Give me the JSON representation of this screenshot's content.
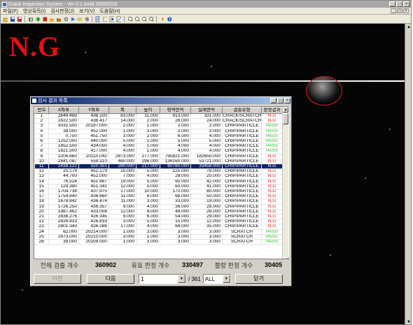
{
  "window": {
    "title": "Crack Inspection System - Ver 0.1 build 20050226",
    "minimize": "_",
    "maximize": "□",
    "close": "×"
  },
  "menu": {
    "items": [
      "파일(F)",
      "영상획득(I)",
      "검사판정(J)",
      "보기(V)",
      "도움말(H)"
    ],
    "mdi_min": "_",
    "mdi_max": "□",
    "mdi_close": "×"
  },
  "toolbar": {
    "buttons": [
      "open-icon",
      "save-icon",
      "save-as-icon",
      "camera-icon",
      "grab-icon",
      "stop-icon",
      "folder-open-icon",
      "folder-save-icon",
      "settings-icon",
      "run-icon",
      "measure-icon",
      "palette-icon",
      "grid-icon",
      "select-icon",
      "area-icon",
      "line-icon",
      "zoom-in-icon",
      "zoom-out-icon",
      "zoom-fit-icon",
      "zoom-icon",
      "info-icon",
      "help-icon"
    ]
  },
  "image": {
    "verdict": "N.G",
    "verdict_color": "#e01010",
    "defect_marker_color": "#e02020"
  },
  "dialog": {
    "title": "검사 결과 목록",
    "columns": [
      "번호",
      "X좌표",
      "Y좌표",
      "폭",
      "높이",
      "영역면적",
      "실제면적",
      "결출유형",
      "판정결과"
    ],
    "rows": [
      [
        "1",
        "2649.489",
        "436.100",
        "83.000",
        "11.000",
        "913.000",
        "331.000",
        "CRACK/SCRATCH",
        "N.G"
      ],
      [
        "2",
        "1622.500",
        "436.417",
        "14.000",
        "2.000",
        "28.000",
        "24.000",
        "CRACK/SCRATCH",
        "N.G"
      ],
      [
        "3",
        "3032.500",
        "20187.000",
        "2.000",
        "1.000",
        "2.000",
        "2.000",
        "CHIP/PARTICLE",
        "PASS"
      ],
      [
        "4",
        "38.000",
        "452.000",
        "1.000",
        "3.000",
        "3.000",
        "3.000",
        "CHIP/PARTICLE",
        "PASS"
      ],
      [
        "5",
        "0.750",
        "451.750",
        "3.000",
        "2.000",
        "6.000",
        "4.000",
        "CHIP/PARTICLE",
        "PASS"
      ],
      [
        "6",
        "1252.000",
        "440.000",
        "5.000",
        "1.000",
        "5.000",
        "5.000",
        "CHIP/PARTICLE",
        "PASS"
      ],
      [
        "7",
        "1852.500",
        "434.000",
        "4.000",
        "1.000",
        "4.000",
        "4.000",
        "CHIP/PARTICLE",
        "PASS"
      ],
      [
        "8",
        "1821.500",
        "417.000",
        "4.000",
        "1.000",
        "4.000",
        "4.000",
        "CHIP/PARTICLE",
        "PASS"
      ],
      [
        "9",
        "2206.660",
        "20110.042",
        "2873.000",
        "277.000",
        "795821.000",
        "182650.000",
        "CHIP/PARTICLE",
        "N.G"
      ],
      [
        "10",
        "2841.087",
        "558.310",
        "460.000",
        "296.000",
        "136160.000",
        "53721.000",
        "CHIP/PARTICLE",
        "N.G"
      ],
      [
        "11",
        "2438.122",
        "520.351",
        "280.000",
        "217.000",
        "60760.000",
        "33458.000",
        "CHIP/PARTICLE",
        "N.G"
      ],
      [
        "12",
        "20.179",
        "452.179",
        "25.000",
        "5.000",
        "125.000",
        "78.000",
        "CHIP/PARTICLE",
        "N.G"
      ],
      [
        "13",
        "44.700",
        "452.000",
        "7.000",
        "4.000",
        "28.000",
        "20.000",
        "CHIP/PARTICLE",
        "N.G"
      ],
      [
        "14",
        "76.524",
        "451.667",
        "19.000",
        "5.000",
        "95.000",
        "42.000",
        "CHIP/PARTICLE",
        "N.G"
      ],
      [
        "15",
        "129.390",
        "451.341",
        "12.000",
        "5.000",
        "60.000",
        "41.000",
        "CHIP/PARTICLE",
        "N.G"
      ],
      [
        "16",
        "1704.738",
        "437.975",
        "17.000",
        "10.000",
        "170.000",
        "80.000",
        "CHIP/PARTICLE",
        "N.G"
      ],
      [
        "17",
        "1754.840",
        "436.660",
        "11.000",
        "6.000",
        "66.000",
        "50.000",
        "CHIP/PARTICLE",
        "N.G"
      ],
      [
        "18",
        "1678.842",
        "436.474",
        "11.000",
        "3.000",
        "33.000",
        "19.000",
        "CHIP/PARTICLE",
        "N.G"
      ],
      [
        "19",
        "1726.250",
        "436.357",
        "9.000",
        "4.000",
        "36.000",
        "28.000",
        "CHIP/PARTICLE",
        "N.G"
      ],
      [
        "20",
        "1987.462",
        "433.008",
        "12.000",
        "4.000",
        "48.000",
        "26.000",
        "CHIP/PARTICLE",
        "N.G"
      ],
      [
        "21",
        "2836.276",
        "426.345",
        "9.000",
        "6.000",
        "54.000",
        "29.000",
        "CHIP/PARTICLE",
        "N.G"
      ],
      [
        "22",
        "2826.833",
        "426.833",
        "3.000",
        "5.000",
        "15.000",
        "12.000",
        "CHIP/PARTICLE",
        "N.G"
      ],
      [
        "23",
        "2801.343",
        "426.286",
        "17.000",
        "4.000",
        "68.000",
        "35.000",
        "CHIP/PARTICLE",
        "N.G"
      ],
      [
        "24",
        "62.000",
        "20214.000",
        "1.000",
        "3.000",
        "3.000",
        "3.000",
        "SCRATCH",
        "PASS"
      ],
      [
        "25",
        "2973.000",
        "20210.000",
        "3.000",
        "1.000",
        "3.000",
        "3.000",
        "SCRATCH",
        "PASS"
      ],
      [
        "26",
        "39.000",
        "20209.000",
        "1.000",
        "3.000",
        "3.000",
        "3.000",
        "SCRATCH",
        "PASS"
      ]
    ],
    "selected_row": 10,
    "stats": {
      "total_label": "전체 검출 개수",
      "total_value": "360902",
      "valid_label": "유효 판정 개수",
      "valid_value": "330497",
      "bad_label": "불량 판정 개수",
      "bad_value": "30405"
    },
    "controls": {
      "prev_label": "이전",
      "next_label": "다음",
      "page_value": "1",
      "page_total": "/ 361",
      "filter_value": "ALL",
      "close_label": "닫기"
    }
  }
}
